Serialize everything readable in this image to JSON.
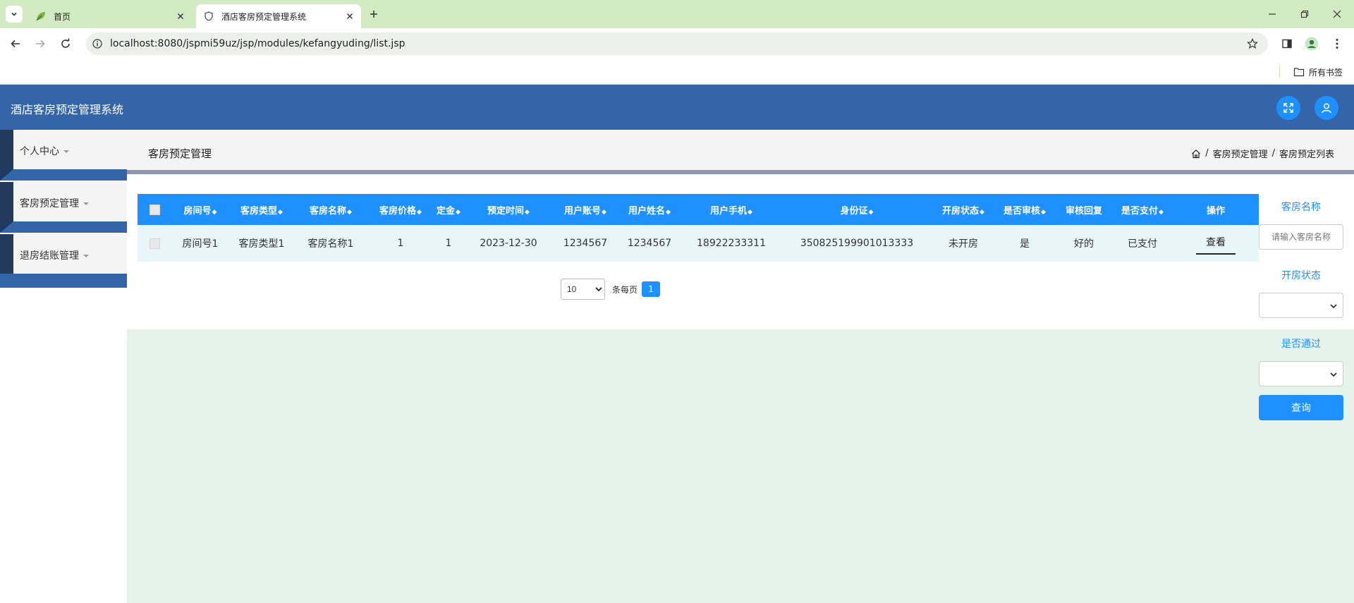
{
  "browser": {
    "tabs": [
      {
        "title": "首页",
        "active": false
      },
      {
        "title": "酒店客房预定管理系统",
        "active": true
      }
    ],
    "url": "localhost:8080/jspmi59uz/jsp/modules/kefangyuding/list.jsp",
    "bookmarks_folder": "所有书签"
  },
  "app": {
    "title": "酒店客房预定管理系统"
  },
  "sidebar": {
    "items": [
      {
        "label": "个人中心"
      },
      {
        "label": "客房预定管理"
      },
      {
        "label": "退房结账管理"
      }
    ]
  },
  "page": {
    "title": "客房预定管理",
    "breadcrumb": [
      "客房预定管理",
      "客房预定列表"
    ]
  },
  "table": {
    "columns": [
      "房间号",
      "客房类型",
      "客房名称",
      "客房价格",
      "定金",
      "预定时间",
      "用户账号",
      "用户姓名",
      "用户手机",
      "身份证",
      "开房状态",
      "是否审核",
      "审核回复",
      "是否支付",
      "操作"
    ],
    "rows": [
      {
        "cells": [
          "房间号1",
          "客房类型1",
          "客房名称1",
          "1",
          "1",
          "2023-12-30",
          "1234567",
          "1234567",
          "18922233311",
          "350825199901013333",
          "未开房",
          "是",
          "好的",
          "已支付"
        ],
        "action": "查看"
      }
    ]
  },
  "pagination": {
    "page_size": "10",
    "per_page_label": "条每页",
    "current_page": "1"
  },
  "search": {
    "room_name_label": "客房名称",
    "room_name_placeholder": "请输入客房名称",
    "status_label": "开房状态",
    "pass_label": "是否通过",
    "query_button": "查询"
  },
  "colors": {
    "header_blue": "#3465a9",
    "accent_blue": "#1e90ff",
    "row_bg": "#e8f6fa",
    "content_bg": "#e6f3ec"
  }
}
